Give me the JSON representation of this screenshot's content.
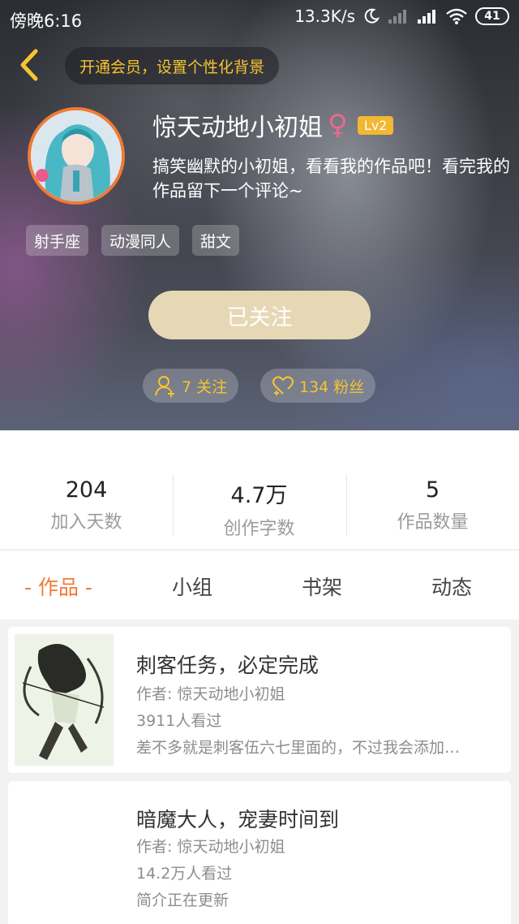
{
  "status_bar": {
    "time": "傍晚6:16",
    "speed": "13.3K/s",
    "battery": "41"
  },
  "header": {
    "vip_prompt": "开通会员，设置个性化背景"
  },
  "profile": {
    "name": "惊天动地小初姐",
    "gender_symbol": "♀",
    "level": "Lv2",
    "bio": "搞笑幽默的小初姐，看看我的作品吧！看完我的作品留下一个评论~",
    "tags": [
      "射手座",
      "动漫同人",
      "甜文"
    ],
    "follow_button": "已关注",
    "following": "7 关注",
    "fans": "134 粉丝"
  },
  "stats": [
    {
      "value": "204",
      "label": "加入天数"
    },
    {
      "value": "4.7万",
      "label": "创作字数"
    },
    {
      "value": "5",
      "label": "作品数量"
    }
  ],
  "tabs": [
    "- 作品 -",
    "小组",
    "书架",
    "动态"
  ],
  "works": [
    {
      "title": "刺客任务，必定完成",
      "author": "作者: 惊天动地小初姐",
      "views": "3911人看过",
      "summary": "差不多就是刺客伍六七里面的，不过我会添加…"
    },
    {
      "title": "暗魔大人，宠妻时间到",
      "author": "作者: 惊天动地小初姐",
      "views": "14.2万人看过",
      "summary": "简介正在更新"
    }
  ],
  "colors": {
    "accent": "#f07a35",
    "gold": "#f5c430",
    "follow_button": "#e6d8b5",
    "level_badge": "#f2b733",
    "gender": "#e86a8e"
  }
}
